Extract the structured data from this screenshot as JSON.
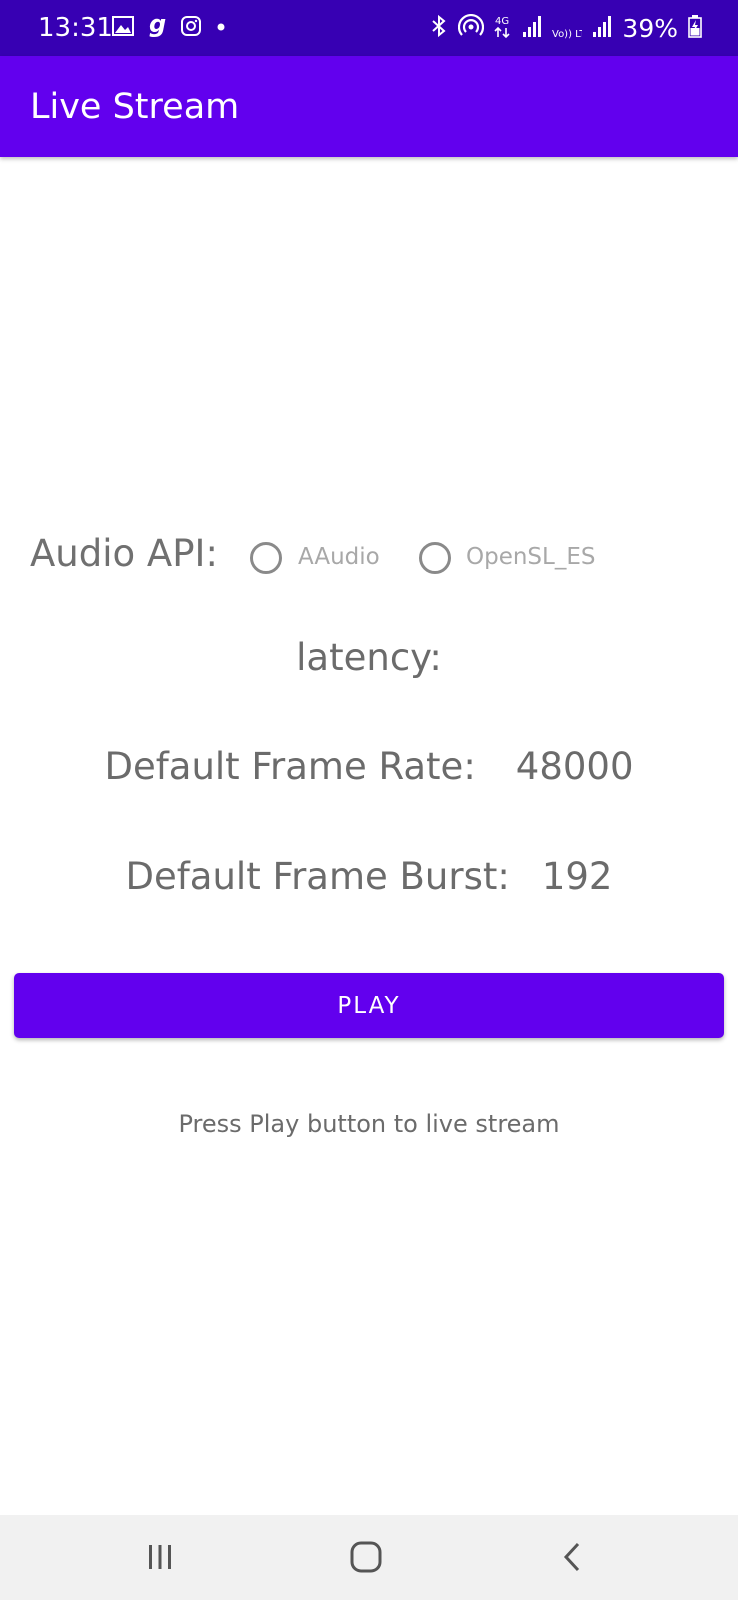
{
  "status_bar": {
    "time": "13:31",
    "battery": "39%",
    "left_icons": [
      "gallery-icon",
      "gaana-icon",
      "instagram-icon",
      "dot-icon"
    ],
    "right_icons": [
      "bluetooth-icon",
      "hotspot-icon",
      "network-4g-icon",
      "signal-icon",
      "volte-icon",
      "signal2-icon",
      "battery-icon"
    ],
    "network_label": "4G",
    "volte_label": "Vo)) LTE2"
  },
  "app_bar": {
    "title": "Live Stream"
  },
  "audio_api": {
    "label": "Audio API:",
    "options": [
      "AAudio",
      "OpenSL_ES"
    ]
  },
  "latency": {
    "label": "latency:"
  },
  "frame_rate": {
    "label": "Default Frame Rate:",
    "value": "48000"
  },
  "frame_burst": {
    "label": "Default Frame Burst:",
    "value": "192"
  },
  "play_button": {
    "label": "PLAY"
  },
  "hint": "Press Play button to live stream",
  "colors": {
    "status_bar": "#3700b3",
    "primary": "#6200ee",
    "nav_bar": "#f1f1f1",
    "text_gray": "#6b6b6b"
  }
}
